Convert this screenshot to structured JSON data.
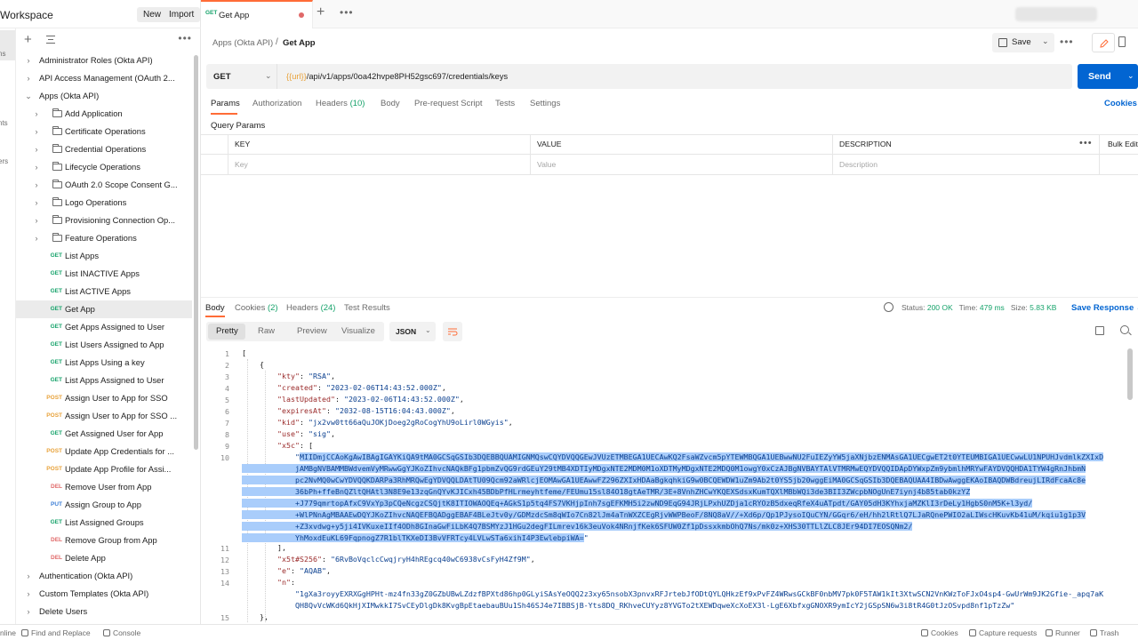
{
  "workspace": {
    "title": "Workspace",
    "new_label": "New",
    "import_label": "Import"
  },
  "leftstrip": [
    "ns",
    "nts",
    "ers"
  ],
  "sidebar": {
    "items": [
      {
        "type": "folder-collapsed",
        "level": 0,
        "label": "Administrator Roles (Okta API)"
      },
      {
        "type": "folder-collapsed",
        "level": 0,
        "label": "API Access Management (OAuth 2..."
      },
      {
        "type": "folder-open",
        "level": 0,
        "label": "Apps (Okta API)"
      },
      {
        "type": "subfolder",
        "level": 1,
        "label": "Add Application"
      },
      {
        "type": "subfolder",
        "level": 1,
        "label": "Certificate Operations"
      },
      {
        "type": "subfolder",
        "level": 1,
        "label": "Credential Operations"
      },
      {
        "type": "subfolder",
        "level": 1,
        "label": "Lifecycle Operations"
      },
      {
        "type": "subfolder",
        "level": 1,
        "label": "OAuth 2.0 Scope Consent G..."
      },
      {
        "type": "subfolder",
        "level": 1,
        "label": "Logo Operations"
      },
      {
        "type": "subfolder",
        "level": 1,
        "label": "Provisioning Connection Op..."
      },
      {
        "type": "subfolder",
        "level": 1,
        "label": "Feature Operations"
      },
      {
        "type": "request",
        "method": "GET",
        "label": "List Apps"
      },
      {
        "type": "request",
        "method": "GET",
        "label": "List INACTIVE Apps"
      },
      {
        "type": "request",
        "method": "GET",
        "label": "List ACTIVE Apps"
      },
      {
        "type": "request",
        "method": "GET",
        "label": "Get App",
        "selected": true
      },
      {
        "type": "request",
        "method": "GET",
        "label": "Get Apps Assigned to User"
      },
      {
        "type": "request",
        "method": "GET",
        "label": "List Users Assigned to App"
      },
      {
        "type": "request",
        "method": "GET",
        "label": "List Apps Using a key"
      },
      {
        "type": "request",
        "method": "GET",
        "label": "List Apps Assigned to User"
      },
      {
        "type": "request",
        "method": "POST",
        "label": "Assign User to App for SSO"
      },
      {
        "type": "request",
        "method": "POST",
        "label": "Assign User to App for SSO ..."
      },
      {
        "type": "request",
        "method": "GET",
        "label": "Get Assigned User for App"
      },
      {
        "type": "request",
        "method": "POST",
        "label": "Update App Credentials for ..."
      },
      {
        "type": "request",
        "method": "POST",
        "label": "Update App Profile for Assi..."
      },
      {
        "type": "request",
        "method": "DEL",
        "label": "Remove User from App"
      },
      {
        "type": "request",
        "method": "PUT",
        "label": "Assign Group to App"
      },
      {
        "type": "request",
        "method": "GET",
        "label": "List Assigned Groups"
      },
      {
        "type": "request",
        "method": "DEL",
        "label": "Remove Group from App"
      },
      {
        "type": "request",
        "method": "DEL",
        "label": "Delete App"
      },
      {
        "type": "folder-collapsed",
        "level": 0,
        "label": "Authentication (Okta API)"
      },
      {
        "type": "folder-collapsed",
        "level": 0,
        "label": "Custom Templates (Okta API)"
      },
      {
        "type": "folder-collapsed",
        "level": 0,
        "label": "Delete Users"
      }
    ]
  },
  "tab": {
    "method": "GET",
    "title": "Get App"
  },
  "breadcrumb": {
    "parent": "Apps (Okta API)",
    "separator": "/",
    "current": "Get App"
  },
  "toolbar": {
    "save_label": "Save"
  },
  "request": {
    "method": "GET",
    "url_var": "{{url}}",
    "url_path": "/api/v1/apps/0oa42hvpe8PH52gsc697/credentials/keys",
    "send_label": "Send",
    "tabs": [
      {
        "label": "Params"
      },
      {
        "label": "Authorization"
      },
      {
        "label": "Headers",
        "count": "(10)"
      },
      {
        "label": "Body"
      },
      {
        "label": "Pre-request Script"
      },
      {
        "label": "Tests"
      },
      {
        "label": "Settings"
      }
    ],
    "cookies_label": "Cookies",
    "query_params_label": "Query Params",
    "table": {
      "headers": [
        "KEY",
        "VALUE",
        "DESCRIPTION"
      ],
      "placeholders": [
        "Key",
        "Value",
        "Description"
      ],
      "bulk_edit": "Bulk Edit"
    }
  },
  "response": {
    "tabs": [
      {
        "label": "Body"
      },
      {
        "label": "Cookies",
        "count": "(2)"
      },
      {
        "label": "Headers",
        "count": "(24)"
      },
      {
        "label": "Test Results"
      }
    ],
    "status_label": "Status:",
    "status": "200 OK",
    "time_label": "Time:",
    "time": "479 ms",
    "size_label": "Size:",
    "size": "5.83 KB",
    "save_label": "Save Response",
    "formats": [
      "Pretty",
      "Raw",
      "Preview",
      "Visualize"
    ],
    "language": "JSON"
  },
  "code": {
    "kty": "RSA",
    "created": "2023-02-06T14:43:52.000Z",
    "lastUpdated": "2023-02-06T14:43:52.000Z",
    "expiresAt": "2032-08-15T16:04:43.000Z",
    "kid": "jx2vw0tt66aQuJOKjDoeg2gRoCogYhU9oLirl0WGyis",
    "use": "sig",
    "x5c_lines": [
      "MIIDmjCCAoKgAwIBAgIGAYKiQA9tMA0GCSqGSIb3DQEBBQUAMIGNMQswCQYDVQQGEwJVUzETMBEGA1UECAwKQ2FsaWZvcm5pYTEWMBQGA1UEBwwNU2FuIEZyYW5jaXNjbzENMAsGA1UECgwET2t0YTEUMBIGA1UECwwLU1NPUHJvdmlkZXIxD",
      "jAMBgNVBAMMBWdvemVyMRwwGgYJKoZIhvcNAQkBFg1pbmZvQG9rdGEuY29tMB4XDTIyMDgxNTE2MDM0M1oXDTMyMDgxNTE2MDQ0M1owgY0xCzAJBgNVBAYTAlVTMRMwEQYDVQQIDApDYWxpZm9ybmlhMRYwFAYDVQQHDA1TYW4gRnJhbmN",
      "pc2NvMQ0wCwYDVQQKDARPa3RhMRQwEgYDVQQLDAtTU09Qcm92aWRlcjEOMAwGA1UEAwwFZ296ZXIxHDAaBgkqhkiG9w0BCQEWDW1uZm9Ab2t0YS5jb20wggEiMA0GCSqGSIb3DQEBAQUAA4IBDwAwggEKAoIBAQDWBdreujLIRdFcaAc8e",
      "36bPh+ffeBnQZltQHAtl3N8E9e13zqGnQYvKJICxh45BDbPfHLrmeyhtfeme/FEUmu15sl84O18gtAeTMR/3E+8VnhZHCwYKQEXSdsxKumTQXlMBbWQi3de3BII3ZWcpbNOgUnE7iynj4b85tab0kzYZ",
      "+J779qmrtopAfxC9VxYp3pCQeNcgzCSQjtK8ITIOWAOQEq+AGkS1p5tq4FS7VKHjpInh7sgEFKMH5i2zwND9EqG94JRjLPxhUZDja1cRYOzB5dxeqRfeX4uATpdt/GAY05dH3KYhxjaMZKlI3rDeLy1HgbS0nM5K+l3yd/",
      "+WlPNnAgMBAAEwDQYJKoZIhvcNAQEFBQADggEBAF4BLeJtv0y/GDMzdcSm8qWIo7Cn82lJm4aTnWXZCEgRjvWWPBeoF/8NQ8aV//+Xd6p/Qp1PJysoIQuCYN/GGqr6/eH/hh2lRtlQ7LJaRQnePWIO2aLIWscHKuvKb41uM/kqiu1g1p3V",
      "+Z3xvdwg+y5ji4IVKuxeIIf4ODh8GInaGwFiLbK4Q7BSMYzJ1HGu2degFILmrev16k3euVok4NRnjfKek6SFUW0Zf1pDssxkmbOhQ7Ns/mk0z+XHS30TTLlZLC8JEr94DI7EOSQNm2/",
      "YhMoxdEuKL69FqpnogZ7R1blTKXeDI3BvVFRTcy4LVLwSTa6xihI4P3EwlebpiWA="
    ],
    "x5t": "6RvBoVqclcCwqjryH4hREgcq40wC6938vCsFyH4Zf9M",
    "e": "AQAB",
    "n_lines": [
      "1gXa3royyEXRXGgHPHt-mz4fn33gZ0GZbUBwLZdzfBPXtd86hp0GLyiSAsYeOQQ2z3xy65nsobX3pnvxRFJrtebJfODtQYLQHkzEf9xPvFZ4WRwsGCkBF0nbMV7pk0F5TAW1kIt3XtwSCN2VnKWzToFJxO4sp4-GwUrWm9JK2Gfie-_apq7aK",
      "QH8QvVcWKd6QkHjXIMwkkI7SvCEyDlgDk8KvgBpEtaebauBUu1Sh46SJ4e7IBBSjB-Yts8DQ_RKhveCUYyz8YVGTo2tXEWDqweXcXoEX3l-LgE6XbfxgGNOXR9ymIcY2jGSpSN6w3i8tR4G0tJzOSvpd8nf1pTzZw"
    ]
  },
  "statusbar": {
    "online": "nline",
    "find_replace": "Find and Replace",
    "console": "Console",
    "cookies": "Cookies",
    "capture": "Capture requests",
    "runner": "Runner",
    "trash": "Trash"
  }
}
